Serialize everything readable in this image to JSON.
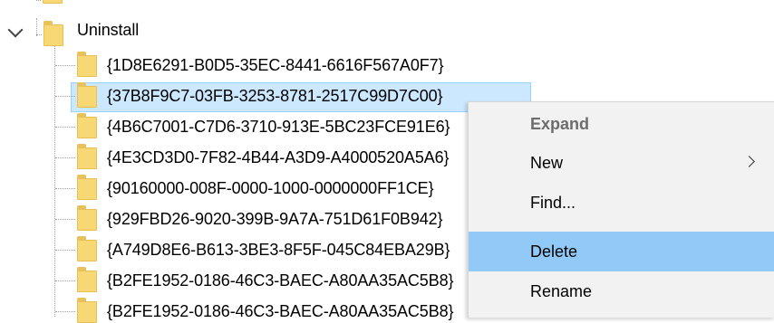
{
  "tree": {
    "parent": {
      "label": "Uninstall"
    },
    "children": [
      {
        "label": "{1D8E6291-B0D5-35EC-8441-6616F567A0F7}"
      },
      {
        "label": "{37B8F9C7-03FB-3253-8781-2517C99D7C00}"
      },
      {
        "label": "{4B6C7001-C7D6-3710-913E-5BC23FCE91E6}"
      },
      {
        "label": "{4E3CD3D0-7F82-4B44-A3D9-A4000520A5A6}"
      },
      {
        "label": "{90160000-008F-0000-1000-0000000FF1CE}"
      },
      {
        "label": "{929FBD26-9020-399B-9A7A-751D61F0B942}"
      },
      {
        "label": "{A749D8E6-B613-3BE3-8F5F-045C84EBA29B}"
      },
      {
        "label": "{B2FE1952-0186-46C3-BAEC-A80AA35AC5B8}"
      },
      {
        "label": "{B2FE1952-0186-46C3-BAEC-A80AA35AC5B8}"
      }
    ]
  },
  "context_menu": {
    "items": [
      {
        "label": "Expand",
        "style": "bold"
      },
      {
        "label": "New",
        "has_submenu": true
      },
      {
        "label": "Find..."
      },
      {
        "label": "Delete",
        "state": "highlighted"
      },
      {
        "label": "Rename"
      }
    ]
  },
  "colors": {
    "selection_bg": "#cce8ff",
    "menu_bg": "#f2f2f2",
    "menu_highlight": "#91c9f7",
    "folder": "#f8d775"
  }
}
